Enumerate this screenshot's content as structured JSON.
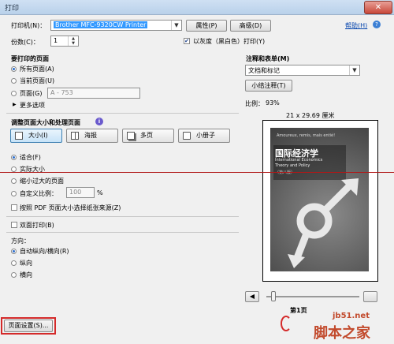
{
  "window": {
    "title": "打印",
    "close_glyph": "✕"
  },
  "printer": {
    "label": "打印机(N)：",
    "value": "Brother MFC-9320CW Printer",
    "properties_button": "属性(P)",
    "advanced_button": "高级(D)",
    "help_link": "帮助(H)"
  },
  "copies": {
    "label": "份数(C)：",
    "value": "1",
    "grayscale_label": "以灰度（黑白色）打印(Y)",
    "grayscale_checked": true
  },
  "pages_to_print": {
    "title": "要打印的页面",
    "options": [
      "所有页面(A)",
      "当前页面(U)",
      "页面(G)"
    ],
    "selected": 0,
    "range_placeholder": "A - 753",
    "more_options": "更多选项"
  },
  "page_sizing": {
    "title": "调整页面大小和处理页面",
    "info_icon": "info-icon",
    "buttons": [
      "大小(I)",
      "海报",
      "多页",
      "小册子"
    ],
    "selected_button": 0,
    "fit_options": [
      "适合(F)",
      "实际大小",
      "缩小过大的页面",
      "自定义比例："
    ],
    "fit_selected": 0,
    "custom_scale_value": "100",
    "percent": "%",
    "pdf_paper_source_label": "按照 PDF 页面大小选择纸张来源(Z)"
  },
  "duplex": {
    "label": "双面打印(B)"
  },
  "orientation": {
    "title": "方向：",
    "options": [
      "自动纵向/横向(R)",
      "纵向",
      "横向"
    ],
    "selected": 0
  },
  "comments": {
    "title": "注释和表单(M)",
    "value": "文档和标记",
    "summarize_button": "小结注释(T)"
  },
  "preview": {
    "scale_label": "比例：",
    "scale_value": "93%",
    "paper_size": "21 x 29.69 厘米",
    "book_title_cn": "国际经济学",
    "book_title_en1": "International Economics",
    "book_title_en2": "Theory and Policy",
    "book_subtitle": "（第八版）",
    "book_tag": "Amoureux, remis, mais entié!",
    "page_indicator": "第1页"
  },
  "footer": {
    "page_setup_button": "页面设置(S)..."
  },
  "watermark": {
    "site": "jb51.net",
    "brand": "脚本之家"
  },
  "colors": {
    "highlight_red": "#d42a2a",
    "selection_blue": "#3399ff"
  }
}
